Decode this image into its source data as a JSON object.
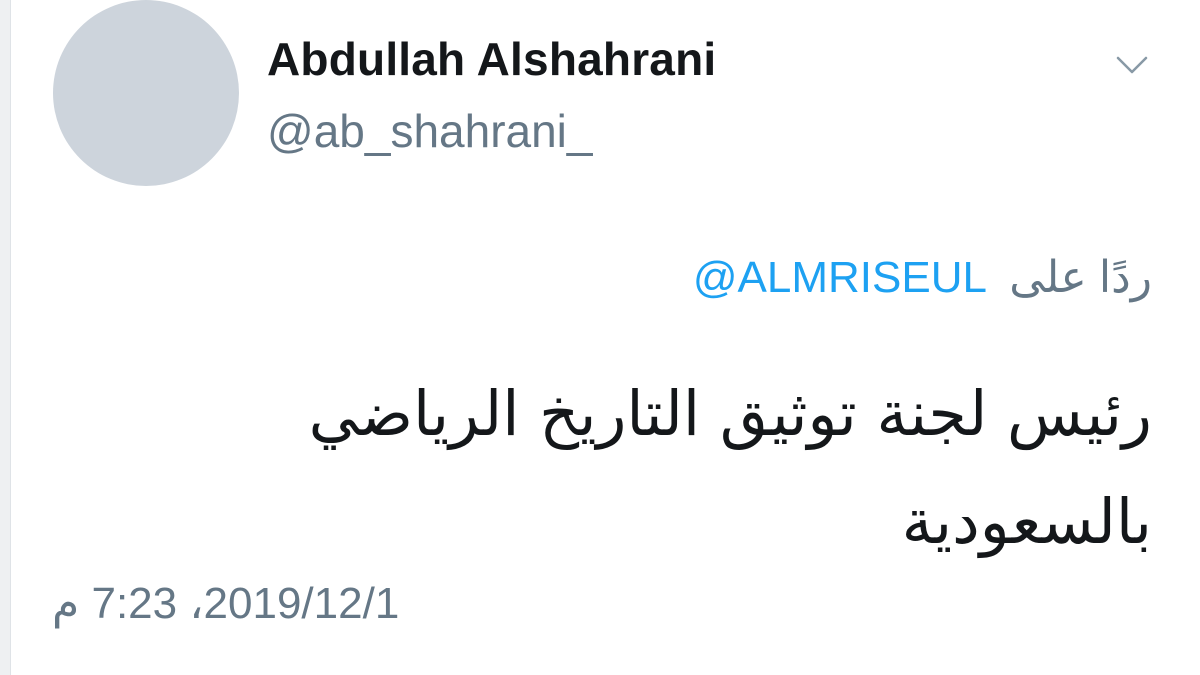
{
  "tweet": {
    "display_name": "Abdullah Alshahrani",
    "handle": "@ab_shahrani_",
    "reply_prefix": "ردًا على",
    "reply_to": "@ALMRISEUL",
    "text": "رئيس لجنة توثيق التاريخ الرياضي بالسعودية",
    "timestamp": "2019/12/1، 7:23 م",
    "menu_icon": "chevron-down-icon"
  },
  "colors": {
    "name": "#14171a",
    "secondary": "#657786",
    "link": "#1da1f2",
    "avatar_placeholder": "#cdd4dc"
  }
}
